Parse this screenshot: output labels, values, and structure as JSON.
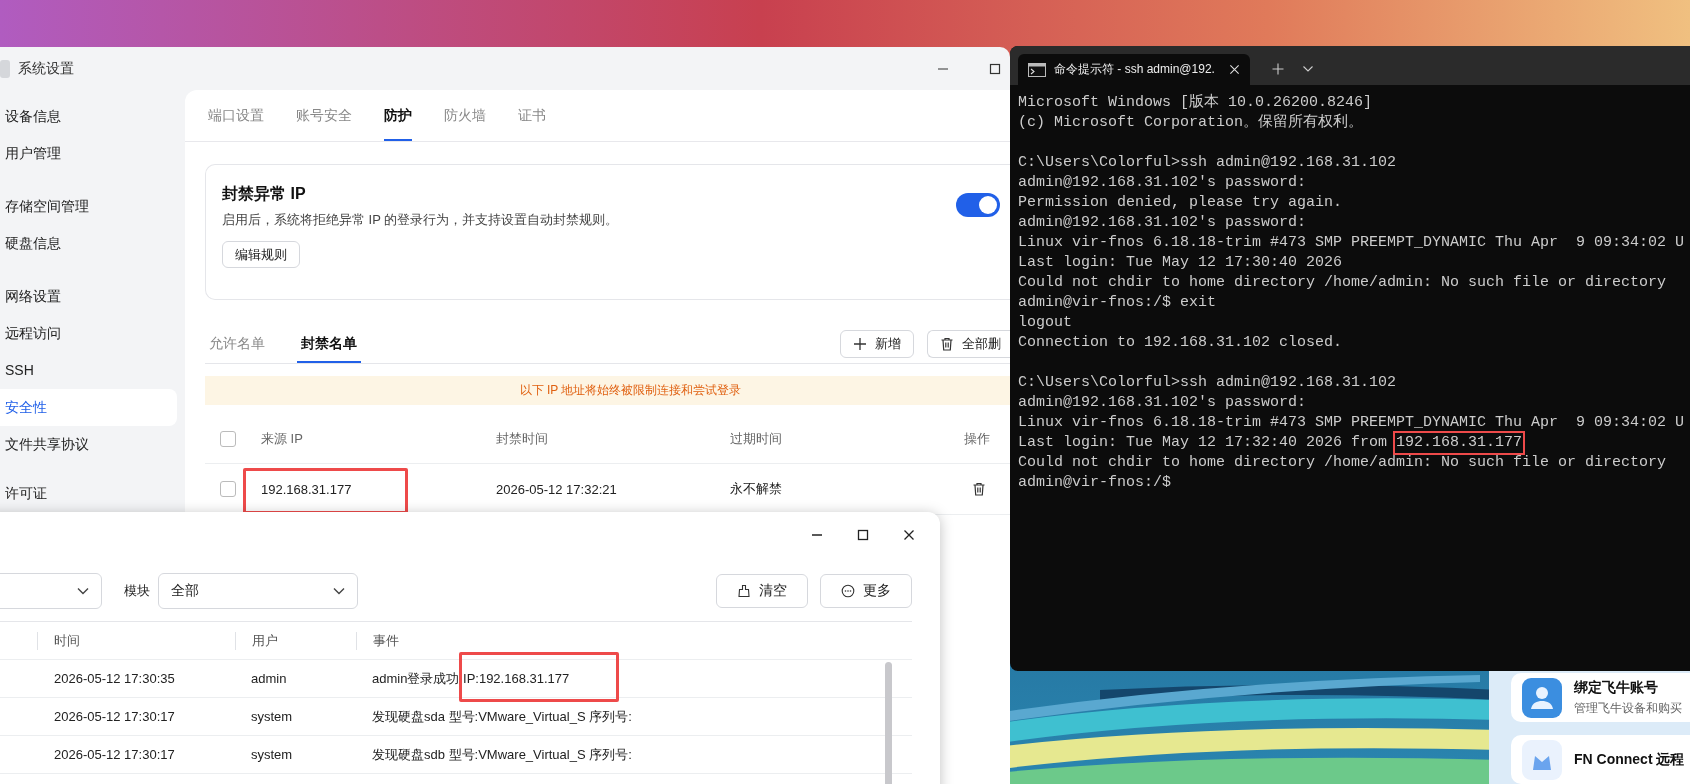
{
  "settings_window": {
    "title": "系统设置",
    "sidebar": {
      "groups": [
        [
          {
            "label": "设备信息",
            "selected": false
          },
          {
            "label": "用户管理",
            "selected": false
          }
        ],
        [
          {
            "label": "存储空间管理",
            "selected": false
          },
          {
            "label": "硬盘信息",
            "selected": false
          }
        ],
        [
          {
            "label": "网络设置",
            "selected": false
          },
          {
            "label": "远程访问",
            "selected": false
          },
          {
            "label": "SSH",
            "selected": false
          },
          {
            "label": "安全性",
            "selected": true
          },
          {
            "label": "文件共享协议",
            "selected": false
          }
        ],
        [
          {
            "label": "许可证",
            "selected": false
          }
        ]
      ]
    },
    "tabs": [
      {
        "label": "端口设置",
        "selected": false
      },
      {
        "label": "账号安全",
        "selected": false
      },
      {
        "label": "防护",
        "selected": true
      },
      {
        "label": "防火墙",
        "selected": false
      },
      {
        "label": "证书",
        "selected": false
      }
    ],
    "card": {
      "title": "封禁异常 IP",
      "description": "启用后，系统将拒绝异常 IP 的登录行为，并支持设置自动封禁规则。",
      "button": "编辑规则",
      "on": true
    },
    "list_tabs": [
      {
        "label": "允许名单",
        "selected": false
      },
      {
        "label": "封禁名单",
        "selected": true
      }
    ],
    "buttons": [
      {
        "kind": "add",
        "label": "新增"
      },
      {
        "kind": "delete",
        "label": "全部删"
      }
    ],
    "notice": "以下 IP 地址将始终被限制连接和尝试登录",
    "table": {
      "select_all_checked": false,
      "columns": [
        "来源 IP",
        "封禁时间",
        "过期时间",
        "操作"
      ],
      "rows": [
        {
          "checked": false,
          "ip": "192.168.31.177",
          "banned_at": "2026-05-12 17:32:21",
          "expires": "永不解禁"
        }
      ]
    }
  },
  "log_window": {
    "filters": [
      {
        "label": "模块",
        "value": "全部"
      }
    ],
    "buttons": [
      {
        "kind": "clear",
        "label": "清空"
      },
      {
        "kind": "more",
        "label": "更多"
      }
    ],
    "columns": [
      "时间",
      "用户",
      "事件"
    ],
    "rows": [
      {
        "time": "2026-05-12 17:30:35",
        "user": "admin",
        "event": "admin登录成功 IP:192.168.31.177"
      },
      {
        "time": "2026-05-12 17:30:17",
        "user": "system",
        "event": "发现硬盘sda 型号:VMware_Virtual_S 序列号:"
      },
      {
        "time": "2026-05-12 17:30:17",
        "user": "system",
        "event": "发现硬盘sdb 型号:VMware_Virtual_S 序列号:"
      }
    ]
  },
  "terminal": {
    "tab_title": "命令提示符 - ssh  admin@192.",
    "blocks": [
      [
        "Microsoft Windows [版本 10.0.26200.8246]",
        "(c) Microsoft Corporation。保留所有权利。"
      ],
      [
        "C:\\Users\\Colorful>ssh admin@192.168.31.102",
        "admin@192.168.31.102's password:",
        "Permission denied, please try again.",
        "admin@192.168.31.102's password:",
        "Linux vir-fnos 6.18.18-trim #473 SMP PREEMPT_DYNAMIC Thu Apr  9 09:34:02 U",
        "Last login: Tue May 12 17:30:40 2026",
        "Could not chdir to home directory /home/admin: No such file or directory",
        "admin@vir-fnos:/$ exit",
        "logout",
        "Connection to 192.168.31.102 closed."
      ],
      [
        "C:\\Users\\Colorful>ssh admin@192.168.31.102",
        "admin@192.168.31.102's password:",
        "Linux vir-fnos 6.18.18-trim #473 SMP PREEMPT_DYNAMIC Thu Apr  9 09:34:02 U",
        {
          "kind": "highlighted",
          "prefix": "Last login: Tue May 12 17:32:40 2026 from",
          "marked": "192.168.31.177"
        },
        "Could not chdir to home directory /home/admin: No such file or directory",
        "admin@vir-fnos:/$"
      ]
    ]
  },
  "side_cards": [
    {
      "kind": "account",
      "title": "绑定飞牛账号",
      "subtitle": "管理飞牛设备和购买"
    },
    {
      "kind": "connect",
      "title": "FN Connect 远程"
    }
  ]
}
